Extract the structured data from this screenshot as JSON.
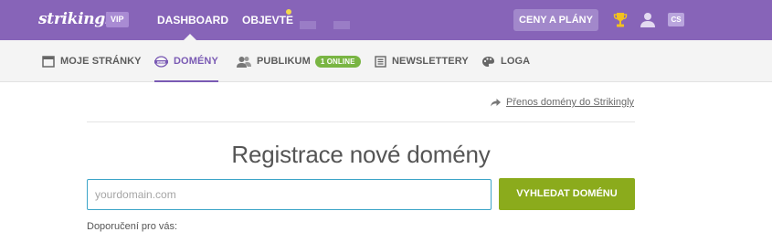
{
  "topbar": {
    "logo": "strikingly",
    "badge": "VIP",
    "nav": [
      {
        "label": "DASHBOARD",
        "active": true
      },
      {
        "label": "OBJEVTE",
        "has_notification": true
      }
    ],
    "pricing_button": "CENY A PLÁNY",
    "language": "CS",
    "icons": [
      "trophy-icon",
      "user-icon"
    ],
    "colors": {
      "background": "#8764b8",
      "notification": "#f3d94b"
    }
  },
  "subnav": {
    "items": [
      {
        "label": "MOJE STRÁNKY",
        "icon": "page-icon"
      },
      {
        "label": "DOMÉNY",
        "icon": "www-icon",
        "active": true
      },
      {
        "label": "PUBLIKUM",
        "icon": "people-icon",
        "badge": "1 ONLINE"
      },
      {
        "label": "NEWSLETTERY",
        "icon": "newsletter-icon"
      },
      {
        "label": "LOGA",
        "icon": "palette-icon"
      }
    ],
    "colors": {
      "active": "#7a5ab4",
      "badge": "#79b543"
    }
  },
  "main": {
    "transfer_link": "Přenos domény do Strikingly",
    "heading": "Registrace nové domény",
    "search": {
      "placeholder": "yourdomain.com",
      "value": ""
    },
    "search_button": "VYHLEDAT DOMÉNU",
    "recommend_label": "Doporučení pro vás:",
    "colors": {
      "input_border": "#3da5c8",
      "button": "#8bab1c"
    }
  }
}
